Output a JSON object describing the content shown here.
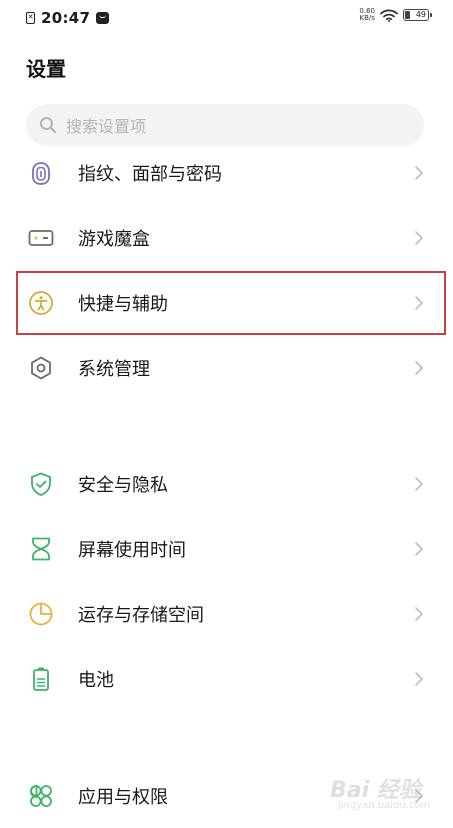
{
  "status_bar": {
    "sim_label": "✕",
    "time": "20:47",
    "net_speed_value": "0.60",
    "net_speed_unit": "KB/s",
    "battery": "49"
  },
  "page": {
    "title": "设置"
  },
  "search": {
    "placeholder": "搜索设置项"
  },
  "settings_items": [
    {
      "label": "指纹、面部与密码",
      "icon": "fingerprint-icon",
      "color": "#7d6cc4"
    },
    {
      "label": "游戏魔盒",
      "icon": "game-box-icon",
      "color": "#6b6b6b"
    },
    {
      "label": "快捷与辅助",
      "icon": "accessibility-icon",
      "color": "#d4a93b"
    },
    {
      "label": "系统管理",
      "icon": "hexagon-settings-icon",
      "color": "#6b6b6b"
    },
    {
      "label": "安全与隐私",
      "icon": "shield-check-icon",
      "color": "#3fb36a"
    },
    {
      "label": "屏幕使用时间",
      "icon": "hourglass-icon",
      "color": "#3fb36a"
    },
    {
      "label": "运存与存储空间",
      "icon": "pie-chart-icon",
      "color": "#e6b23c"
    },
    {
      "label": "电池",
      "icon": "battery-icon",
      "color": "#3fb36a"
    },
    {
      "label": "应用与权限",
      "icon": "apps-icon",
      "color": "#3fb36a"
    }
  ],
  "highlight_color": "#c9423f",
  "watermark": {
    "brand": "Bai  经验",
    "url": "jingyan.baidu.com"
  }
}
